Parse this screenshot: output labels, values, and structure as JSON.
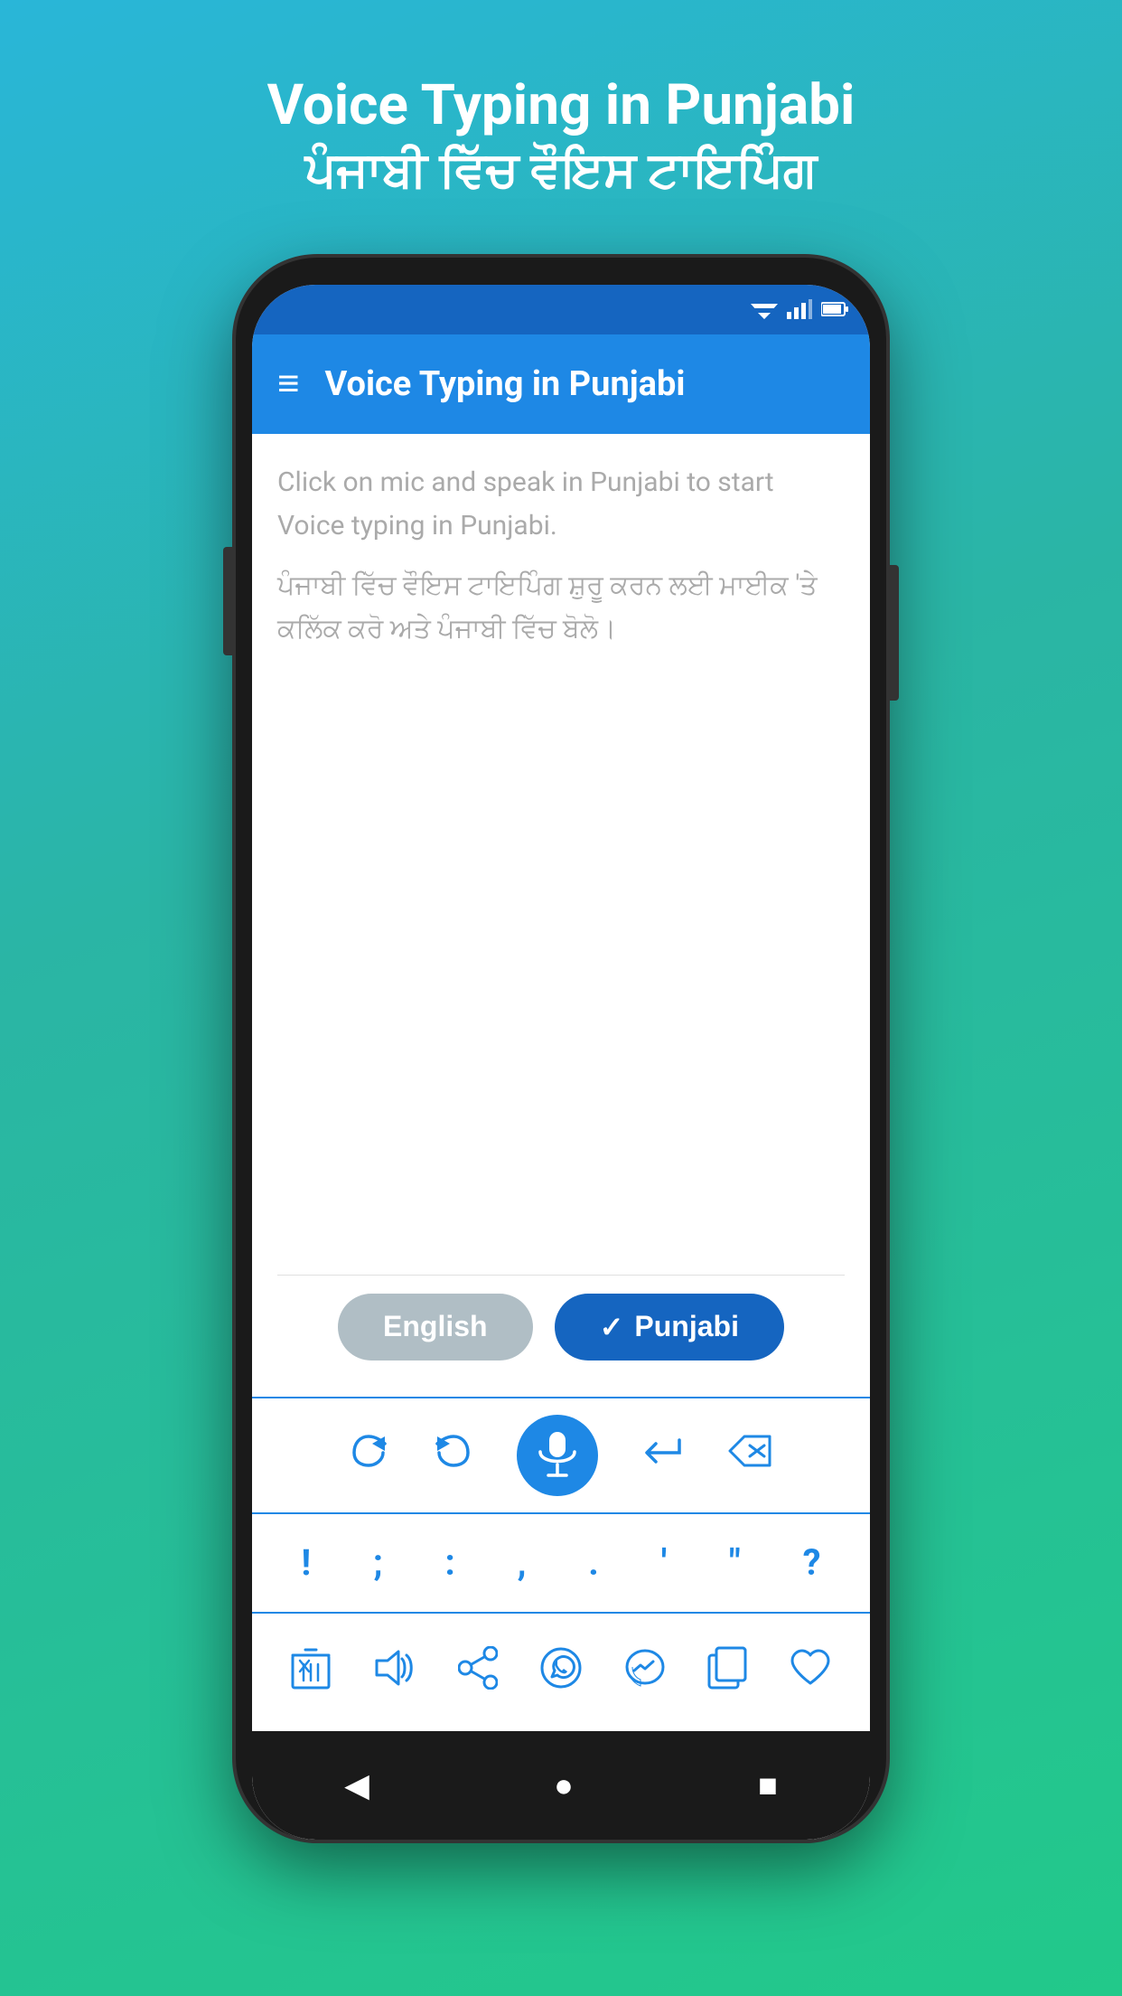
{
  "page": {
    "background_gradient": "linear-gradient(160deg, #29b6d8 0%, #2ab5a5 40%, #22c98a 100%)"
  },
  "app_title": {
    "english": "Voice Typing in Punjabi",
    "punjabi": "ਪੰਜਾਬੀ ਵਿੱਚ ਵੌਇਸ ਟਾਇਪਿੰਗ"
  },
  "status_bar": {
    "wifi": "▲",
    "signal": "▲",
    "battery": "▐"
  },
  "app_bar": {
    "menu_icon": "≡",
    "title": "Voice Typing in Punjabi"
  },
  "text_area": {
    "placeholder_en": "Click on mic and speak in Punjabi to start Voice typing in Punjabi.",
    "placeholder_pn": "ਪੰਜਾਬੀ ਵਿੱਚ ਵੌਇਸ ਟਾਇਪਿੰਗ ਸ਼ੁਰੂ ਕਰਨ ਲਈ ਮਾਈਕ 'ਤੇ ਕਲਿੱਕ ਕਰੋ ਅਤੇ ਪੰਜਾਬੀ ਵਿੱਚ ਬੋਲੋ।"
  },
  "language_buttons": {
    "english": {
      "label": "English",
      "active": false
    },
    "punjabi": {
      "label": "Punjabi",
      "active": true,
      "check": "✓"
    }
  },
  "mic_row": {
    "redo_icon": "↷",
    "undo_icon": "↩",
    "mic_label": "mic",
    "return_icon": "↵",
    "backspace_icon": "⌫"
  },
  "punctuation_row": {
    "keys": [
      "!",
      ";",
      ":",
      ",",
      ".",
      "'",
      "\"",
      "?"
    ]
  },
  "action_row": {
    "actions": [
      "delete",
      "speaker",
      "share",
      "whatsapp",
      "messenger",
      "copy",
      "favorite"
    ]
  },
  "nav_bar": {
    "back_label": "◀",
    "home_label": "●",
    "recent_label": "■"
  }
}
